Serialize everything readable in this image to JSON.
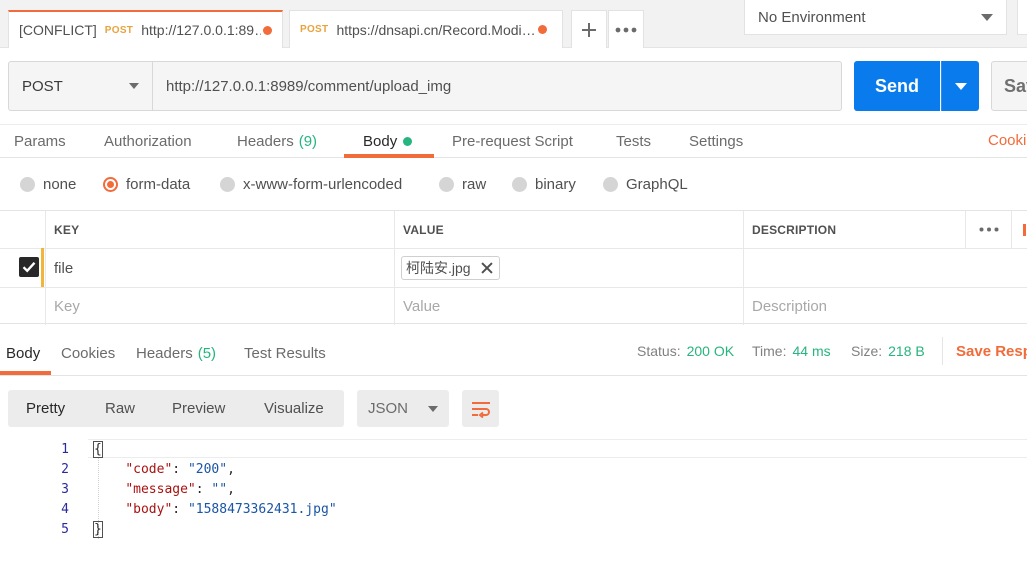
{
  "tabs": [
    {
      "prefix": "[CONFLICT]",
      "method": "POST",
      "url": "http://127.0.0.1:89…"
    },
    {
      "method": "POST",
      "url": "https://dnsapi.cn/Record.Modi…"
    }
  ],
  "tab_actions": {
    "add_icon": "plus-icon",
    "more_icon": "ellipsis-icon"
  },
  "environment": {
    "selected": "No Environment"
  },
  "request": {
    "method": "POST",
    "url": "http://127.0.0.1:8989/comment/upload_img",
    "send_label": "Send",
    "save_label": "Save"
  },
  "request_tabs": [
    {
      "label": "Params"
    },
    {
      "label": "Authorization"
    },
    {
      "label": "Headers",
      "count": "(9)"
    },
    {
      "label": "Body",
      "active": true
    },
    {
      "label": "Pre-request Script"
    },
    {
      "label": "Tests"
    },
    {
      "label": "Settings"
    }
  ],
  "cookies_label": "Cookies",
  "body_types": [
    {
      "label": "none"
    },
    {
      "label": "form-data",
      "selected": true
    },
    {
      "label": "x-www-form-urlencoded"
    },
    {
      "label": "raw"
    },
    {
      "label": "binary"
    },
    {
      "label": "GraphQL"
    }
  ],
  "form_table": {
    "headers": {
      "key": "KEY",
      "value": "VALUE",
      "description": "DESCRIPTION"
    },
    "rows": [
      {
        "checked": true,
        "key": "file",
        "value_file": "柯陆安.jpg",
        "description": ""
      }
    ],
    "placeholders": {
      "key": "Key",
      "value": "Value",
      "description": "Description"
    }
  },
  "response": {
    "tabs": [
      {
        "label": "Body",
        "active": true
      },
      {
        "label": "Cookies"
      },
      {
        "label": "Headers",
        "count": "(5)"
      },
      {
        "label": "Test Results"
      }
    ],
    "status_label": "Status:",
    "status_value": "200 OK",
    "time_label": "Time:",
    "time_value": "44 ms",
    "size_label": "Size:",
    "size_value": "218 B",
    "save_label": "Save Response",
    "view_modes": [
      "Pretty",
      "Raw",
      "Preview",
      "Visualize"
    ],
    "active_view": "Pretty",
    "format": "JSON",
    "wrap_icon": "wrap-lines-icon",
    "code_lines": [
      {
        "n": "1",
        "text": "{"
      },
      {
        "n": "2",
        "key": "\"code\"",
        "value": "\"200\"",
        "trail": ","
      },
      {
        "n": "3",
        "key": "\"message\"",
        "value": "\"\"",
        "trail": ","
      },
      {
        "n": "4",
        "key": "\"body\"",
        "value": "\"1588473362431.jpg\"",
        "trail": ""
      },
      {
        "n": "5",
        "text": "}"
      }
    ]
  },
  "colors": {
    "accent": "#f26b3a",
    "send": "#097bed",
    "success": "#26b47f",
    "method_tag": "#e8a33d"
  }
}
